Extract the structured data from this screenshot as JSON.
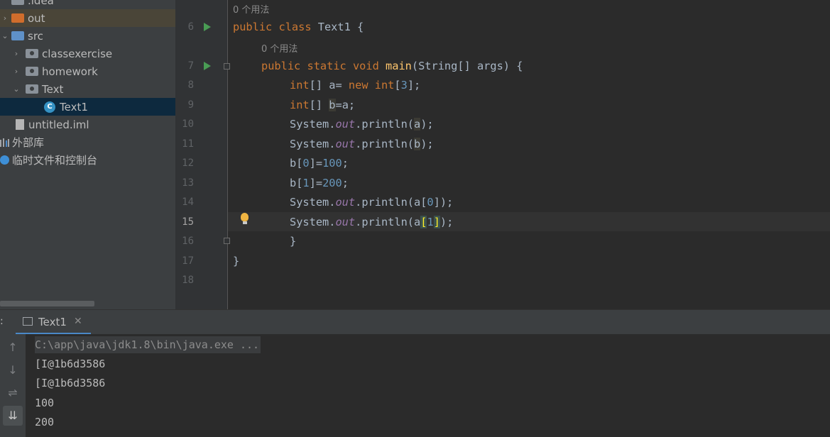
{
  "project_tree": {
    "items": [
      {
        "label": ".idea",
        "type": "folder"
      },
      {
        "label": "out",
        "type": "folder"
      },
      {
        "label": "src",
        "type": "folder"
      },
      {
        "label": "classexercise",
        "type": "package"
      },
      {
        "label": "homework",
        "type": "package"
      },
      {
        "label": "Text",
        "type": "package"
      },
      {
        "label": "Text1",
        "type": "class"
      },
      {
        "label": "untitled.iml",
        "type": "file"
      },
      {
        "label": "外部库",
        "type": "libraries"
      },
      {
        "label": "临时文件和控制台",
        "type": "scratches"
      }
    ]
  },
  "editor": {
    "usage_hint": "0 个用法",
    "line_numbers": [
      "6",
      "7",
      "8",
      "9",
      "10",
      "11",
      "12",
      "13",
      "14",
      "15",
      "16",
      "17",
      "18"
    ],
    "current_line": "15",
    "code": {
      "l6": {
        "kw1": "public",
        "kw2": "class",
        "name": "Text1",
        "rest": " {"
      },
      "l7": {
        "kw1": "public",
        "kw2": "static",
        "kw3": "void",
        "fn": "main",
        "rest": "(String[] args) {"
      },
      "l8": {
        "type": "int",
        "decl": "[] a= ",
        "kw": "new",
        "type2": "int",
        "open": "[",
        "num": "3",
        "close": "];"
      },
      "l9": {
        "type": "int",
        "decl": "[] ",
        "var": "b",
        "rest": "=a;"
      },
      "l10": {
        "obj": "System.",
        "fld": "out",
        "call": ".println(",
        "arg": "a",
        "end": ");"
      },
      "l11": {
        "obj": "System.",
        "fld": "out",
        "call": ".println(",
        "arg": "b",
        "end": ");"
      },
      "l12": {
        "pre": "b[",
        "idx": "0",
        "mid": "]=",
        "val": "100",
        "end": ";"
      },
      "l13": {
        "pre": "b[",
        "idx": "1",
        "mid": "]=",
        "val": "200",
        "end": ";"
      },
      "l14": {
        "obj": "System.",
        "fld": "out",
        "call": ".println(a[",
        "idx": "0",
        "end": "]);"
      },
      "l15": {
        "obj": "System.",
        "fld": "out",
        "call": ".println(a",
        "br1": "[",
        "idx": "1",
        "br2": "]",
        "end": ");"
      },
      "l16": {
        "text": "}"
      },
      "l17": {
        "text": "}"
      }
    }
  },
  "run_panel": {
    "tool_label": ":",
    "tab_title": "Text1",
    "tab_close": "✕",
    "console_lines": [
      "C:\\app\\java\\jdk1.8\\bin\\java.exe ...",
      "[I@1b6d3586",
      "[I@1b6d3586",
      "100",
      "200"
    ],
    "toolbar_icons": [
      "arrow-up-icon",
      "arrow-down-icon",
      "soft-wrap-icon",
      "scroll-to-end-icon"
    ]
  }
}
